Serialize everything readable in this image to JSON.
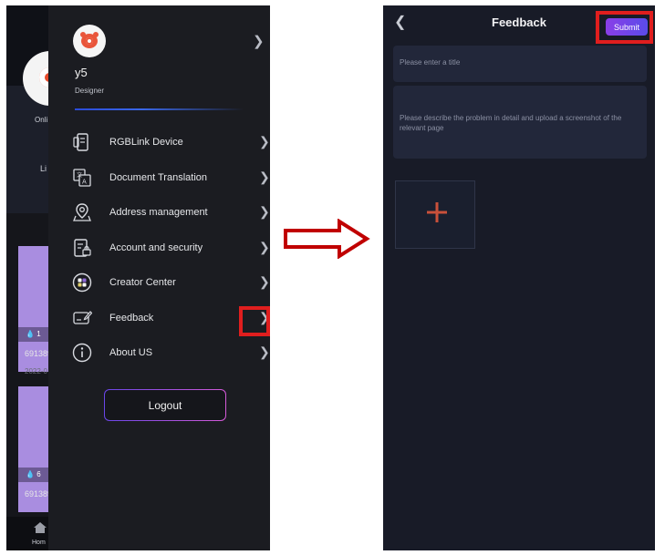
{
  "left_screen": {
    "background_app": {
      "avatar_status": "Onli",
      "stat_label": "Li",
      "card1_badge": "1",
      "card1_number": "691389",
      "card1_date": "2022-0",
      "card2_badge": "6",
      "card2_number": "691389",
      "bottom_nav_home": "Hom"
    },
    "drawer": {
      "user_name": "y5",
      "user_role": "Designer",
      "menu": [
        {
          "label": "RGBLink Device",
          "icon": "device-icon"
        },
        {
          "label": "Document Translation",
          "icon": "translate-icon"
        },
        {
          "label": "Address management",
          "icon": "location-pin-icon"
        },
        {
          "label": "Account and security",
          "icon": "account-security-icon"
        },
        {
          "label": "Creator Center",
          "icon": "creator-center-icon"
        },
        {
          "label": "Feedback",
          "icon": "feedback-icon"
        },
        {
          "label": "About US",
          "icon": "info-icon"
        }
      ],
      "logout_label": "Logout"
    }
  },
  "right_screen": {
    "title": "Feedback",
    "submit_label": "Submit",
    "title_placeholder": "Please enter a title",
    "description_placeholder": "Please describe the problem in detail and upload a screenshot of the relevant page"
  },
  "colors": {
    "highlight": "#e01e1e",
    "accent_gradient_start": "#8a3ee7",
    "accent_gradient_end": "#5a4bea",
    "plus_color": "#c9503a"
  }
}
